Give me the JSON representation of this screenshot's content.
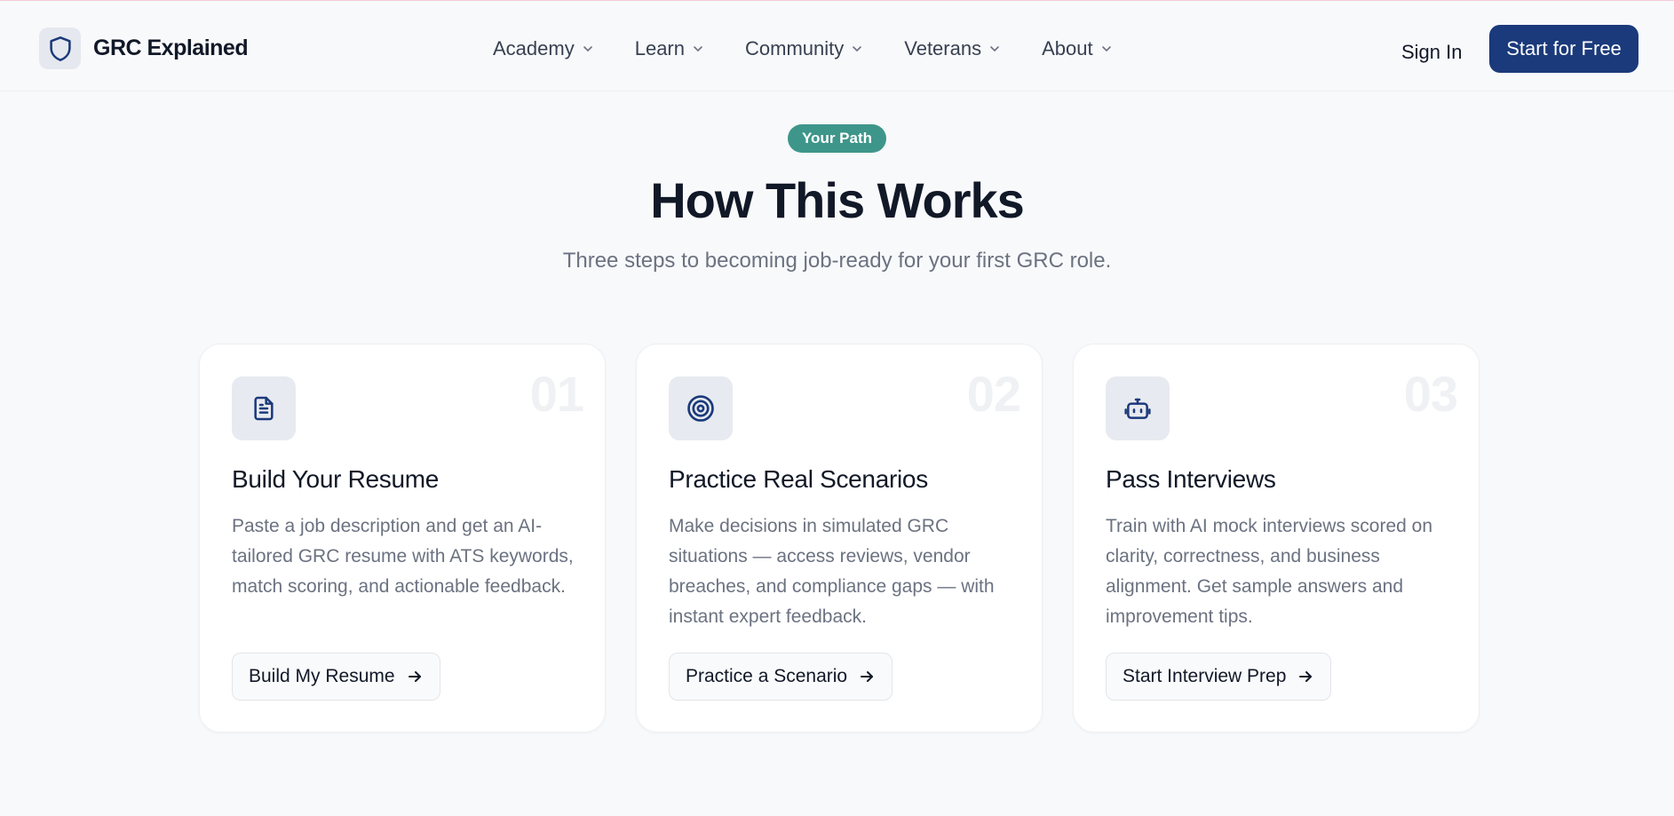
{
  "brand": {
    "name": "GRC Explained",
    "logo_icon": "shield-icon"
  },
  "nav": {
    "items": [
      {
        "label": "Academy"
      },
      {
        "label": "Learn"
      },
      {
        "label": "Community"
      },
      {
        "label": "Veterans"
      },
      {
        "label": "About"
      }
    ],
    "sign_in": "Sign In",
    "cta": "Start for Free"
  },
  "hero": {
    "badge": "Your Path",
    "title": "How This Works",
    "subtitle": "Three steps to becoming job-ready for your first GRC role."
  },
  "cards": [
    {
      "number": "01",
      "icon": "document-icon",
      "title": "Build Your Resume",
      "description": "Paste a job description and get an AI-tailored GRC resume with ATS keywords, match scoring, and actionable feedback.",
      "button": "Build My Resume"
    },
    {
      "number": "02",
      "icon": "target-icon",
      "title": "Practice Real Scenarios",
      "description": "Make decisions in simulated GRC situations — access reviews, vendor breaches, and compliance gaps — with instant expert feedback.",
      "button": "Practice a Scenario"
    },
    {
      "number": "03",
      "icon": "robot-icon",
      "title": "Pass Interviews",
      "description": "Train with AI mock interviews scored on clarity, correctness, and business alignment. Get sample answers and improvement tips.",
      "button": "Start Interview Prep"
    }
  ],
  "colors": {
    "primary": "#1b3a7b",
    "badge": "#3e968a",
    "background": "#f8f9fb"
  }
}
